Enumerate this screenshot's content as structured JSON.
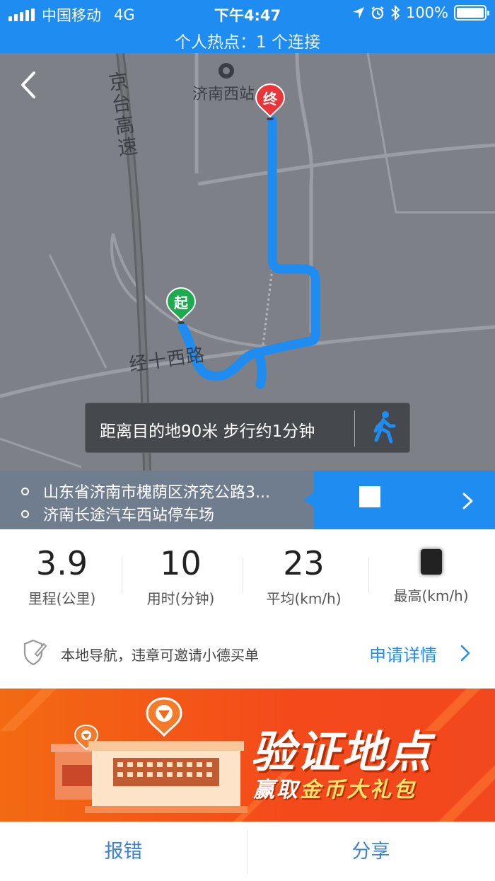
{
  "status_bar": {
    "carrier": "中国移动",
    "network": "4G",
    "time": "下午4:47",
    "battery": "100%",
    "hotspot": "个人热点：1 个连接"
  },
  "map": {
    "station_label": "济南西站",
    "highway_label": "京台高速",
    "road_label": "经十西路",
    "start_pin": "起",
    "end_pin": "终",
    "info": "距离目的地90米 步行约1分钟",
    "route_color": "#1e8cf0"
  },
  "address": {
    "from": "山东省济南市槐荫区济兖公路3...",
    "to": "济南长途汽车西站停车场"
  },
  "stats": [
    {
      "value": "3.9",
      "label": "里程(公里)"
    },
    {
      "value": "10",
      "label": "用时(分钟)"
    },
    {
      "value": "23",
      "label": "平均(km/h)"
    },
    {
      "value": "",
      "label": "最高(km/h)"
    }
  ],
  "violation": {
    "text": "本地导航，违章可邀请小德买单",
    "link": "申请详情"
  },
  "banner": {
    "title": "验证地点",
    "sub_prefix": "赢取",
    "sub_gold": "金币大礼包"
  },
  "footer": {
    "report": "报错",
    "share": "分享"
  }
}
